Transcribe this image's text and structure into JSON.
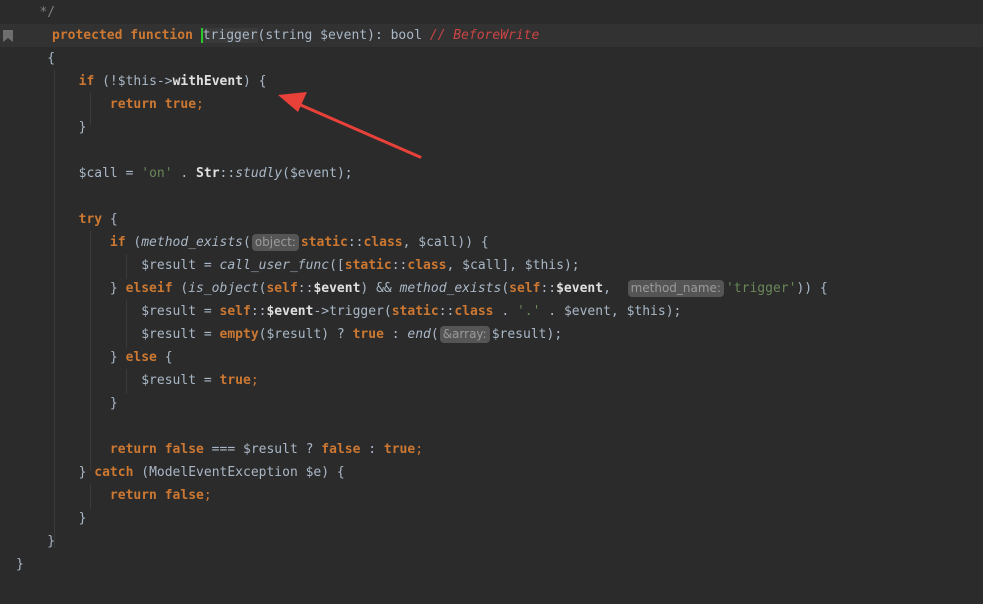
{
  "lines": [
    {
      "tokens": [
        {
          "t": "   */",
          "c": "cmt"
        }
      ]
    },
    {
      "current": true,
      "tokens": [
        {
          "t": "protected",
          "c": "kw"
        },
        {
          "t": " ",
          "c": ""
        },
        {
          "t": "function",
          "c": "kw"
        },
        {
          "t": " ",
          "c": ""
        },
        {
          "t": "trigger",
          "c": "caret-word"
        },
        {
          "t": "(string ",
          "c": ""
        },
        {
          "t": "$event",
          "c": "var"
        },
        {
          "t": "): bool ",
          "c": ""
        },
        {
          "t": "// ",
          "c": "cmt-it"
        },
        {
          "t": "BeforeWrite",
          "c": "cmt-it"
        }
      ]
    },
    {
      "tokens": [
        {
          "t": "    {",
          "c": ""
        }
      ]
    },
    {
      "tokens": [
        {
          "t": "        ",
          "c": ""
        },
        {
          "t": "if",
          "c": "kw"
        },
        {
          "t": " (!",
          "c": ""
        },
        {
          "t": "$this",
          "c": "var"
        },
        {
          "t": "->",
          "c": ""
        },
        {
          "t": "withEvent",
          "c": "bold"
        },
        {
          "t": ") {",
          "c": ""
        }
      ]
    },
    {
      "tokens": [
        {
          "t": "            ",
          "c": ""
        },
        {
          "t": "return",
          "c": "kw"
        },
        {
          "t": " ",
          "c": ""
        },
        {
          "t": "true",
          "c": "kw"
        },
        {
          "t": ";",
          "c": "kwn"
        }
      ]
    },
    {
      "tokens": [
        {
          "t": "        }",
          "c": ""
        }
      ]
    },
    {
      "tokens": []
    },
    {
      "tokens": [
        {
          "t": "        ",
          "c": ""
        },
        {
          "t": "$call",
          "c": "var"
        },
        {
          "t": " = ",
          "c": ""
        },
        {
          "t": "'on'",
          "c": "str"
        },
        {
          "t": " . ",
          "c": ""
        },
        {
          "t": "Str",
          "c": "bold"
        },
        {
          "t": "::",
          "c": ""
        },
        {
          "t": "studly",
          "c": "fn-it"
        },
        {
          "t": "(",
          "c": ""
        },
        {
          "t": "$event",
          "c": "var"
        },
        {
          "t": ");",
          "c": ""
        }
      ]
    },
    {
      "tokens": []
    },
    {
      "tokens": [
        {
          "t": "        ",
          "c": ""
        },
        {
          "t": "try",
          "c": "kw"
        },
        {
          "t": " {",
          "c": ""
        }
      ]
    },
    {
      "tokens": [
        {
          "t": "            ",
          "c": ""
        },
        {
          "t": "if",
          "c": "kw"
        },
        {
          "t": " (",
          "c": ""
        },
        {
          "t": "method_exists",
          "c": "fn-it"
        },
        {
          "t": "(",
          "c": ""
        },
        {
          "t": "object:",
          "c": "hint"
        },
        {
          "t": "static",
          "c": "kw"
        },
        {
          "t": "::",
          "c": ""
        },
        {
          "t": "class",
          "c": "kw"
        },
        {
          "t": ", ",
          "c": ""
        },
        {
          "t": "$call",
          "c": "var"
        },
        {
          "t": ")) {",
          "c": ""
        }
      ]
    },
    {
      "tokens": [
        {
          "t": "                ",
          "c": ""
        },
        {
          "t": "$result",
          "c": "var"
        },
        {
          "t": " = ",
          "c": ""
        },
        {
          "t": "call_user_func",
          "c": "fn-it"
        },
        {
          "t": "([",
          "c": ""
        },
        {
          "t": "static",
          "c": "kw"
        },
        {
          "t": "::",
          "c": ""
        },
        {
          "t": "class",
          "c": "kw"
        },
        {
          "t": ", ",
          "c": ""
        },
        {
          "t": "$call",
          "c": "var"
        },
        {
          "t": "], ",
          "c": ""
        },
        {
          "t": "$this",
          "c": "var"
        },
        {
          "t": ");",
          "c": ""
        }
      ]
    },
    {
      "tokens": [
        {
          "t": "            } ",
          "c": ""
        },
        {
          "t": "elseif",
          "c": "kw"
        },
        {
          "t": " (",
          "c": ""
        },
        {
          "t": "is_object",
          "c": "fn-it"
        },
        {
          "t": "(",
          "c": ""
        },
        {
          "t": "self",
          "c": "kw"
        },
        {
          "t": "::",
          "c": ""
        },
        {
          "t": "$event",
          "c": "bold"
        },
        {
          "t": ") && ",
          "c": ""
        },
        {
          "t": "method_exists",
          "c": "fn-it"
        },
        {
          "t": "(",
          "c": ""
        },
        {
          "t": "self",
          "c": "kw"
        },
        {
          "t": "::",
          "c": ""
        },
        {
          "t": "$event",
          "c": "bold"
        },
        {
          "t": ",  ",
          "c": ""
        },
        {
          "t": "method_name:",
          "c": "hint"
        },
        {
          "t": "'trigger'",
          "c": "str"
        },
        {
          "t": ")) {",
          "c": ""
        }
      ]
    },
    {
      "tokens": [
        {
          "t": "                ",
          "c": ""
        },
        {
          "t": "$result",
          "c": "var"
        },
        {
          "t": " = ",
          "c": ""
        },
        {
          "t": "self",
          "c": "kw"
        },
        {
          "t": "::",
          "c": ""
        },
        {
          "t": "$event",
          "c": "bold"
        },
        {
          "t": "->trigger(",
          "c": ""
        },
        {
          "t": "static",
          "c": "kw"
        },
        {
          "t": "::",
          "c": ""
        },
        {
          "t": "class",
          "c": "kw"
        },
        {
          "t": " . ",
          "c": ""
        },
        {
          "t": "'.'",
          "c": "str"
        },
        {
          "t": " . ",
          "c": ""
        },
        {
          "t": "$event",
          "c": "var"
        },
        {
          "t": ", ",
          "c": ""
        },
        {
          "t": "$this",
          "c": "var"
        },
        {
          "t": ");",
          "c": ""
        }
      ]
    },
    {
      "tokens": [
        {
          "t": "                ",
          "c": ""
        },
        {
          "t": "$result",
          "c": "var"
        },
        {
          "t": " = ",
          "c": ""
        },
        {
          "t": "empty",
          "c": "kw"
        },
        {
          "t": "(",
          "c": ""
        },
        {
          "t": "$result",
          "c": "var"
        },
        {
          "t": ") ? ",
          "c": ""
        },
        {
          "t": "true",
          "c": "kw"
        },
        {
          "t": " : ",
          "c": ""
        },
        {
          "t": "end",
          "c": "fn-it"
        },
        {
          "t": "(",
          "c": ""
        },
        {
          "t": "&array:",
          "c": "hint"
        },
        {
          "t": "$result",
          "c": "var"
        },
        {
          "t": ");",
          "c": ""
        }
      ]
    },
    {
      "tokens": [
        {
          "t": "            } ",
          "c": ""
        },
        {
          "t": "else",
          "c": "kw"
        },
        {
          "t": " {",
          "c": ""
        }
      ]
    },
    {
      "tokens": [
        {
          "t": "                ",
          "c": ""
        },
        {
          "t": "$result",
          "c": "var"
        },
        {
          "t": " = ",
          "c": ""
        },
        {
          "t": "true",
          "c": "kw"
        },
        {
          "t": ";",
          "c": "kwn"
        }
      ]
    },
    {
      "tokens": [
        {
          "t": "            }",
          "c": ""
        }
      ]
    },
    {
      "tokens": []
    },
    {
      "tokens": [
        {
          "t": "            ",
          "c": ""
        },
        {
          "t": "return",
          "c": "kw"
        },
        {
          "t": " ",
          "c": ""
        },
        {
          "t": "false",
          "c": "kw"
        },
        {
          "t": " === ",
          "c": ""
        },
        {
          "t": "$result",
          "c": "var"
        },
        {
          "t": " ? ",
          "c": ""
        },
        {
          "t": "false",
          "c": "kw"
        },
        {
          "t": " : ",
          "c": ""
        },
        {
          "t": "true",
          "c": "kw"
        },
        {
          "t": ";",
          "c": "kwn"
        }
      ]
    },
    {
      "tokens": [
        {
          "t": "        } ",
          "c": ""
        },
        {
          "t": "catch",
          "c": "kw"
        },
        {
          "t": " (ModelEventException ",
          "c": ""
        },
        {
          "t": "$e",
          "c": "var"
        },
        {
          "t": ") {",
          "c": ""
        }
      ]
    },
    {
      "tokens": [
        {
          "t": "            ",
          "c": ""
        },
        {
          "t": "return",
          "c": "kw"
        },
        {
          "t": " ",
          "c": ""
        },
        {
          "t": "false",
          "c": "kw"
        },
        {
          "t": ";",
          "c": "kwn"
        }
      ]
    },
    {
      "tokens": [
        {
          "t": "        }",
          "c": ""
        }
      ]
    },
    {
      "tokens": [
        {
          "t": "    }",
          "c": ""
        }
      ]
    },
    {
      "tokens": [
        {
          "t": "}",
          "c": ""
        }
      ]
    }
  ],
  "colors": {
    "background": "#2b2b2b",
    "keyword": "#cc7832",
    "string": "#6a8759",
    "comment": "#808080",
    "todo_comment": "#cc4444",
    "annotation_arrow": "#e8413a",
    "caret": "#29c929"
  },
  "annotation": {
    "icon": "red-arrow-icon",
    "target": "withEvent"
  }
}
